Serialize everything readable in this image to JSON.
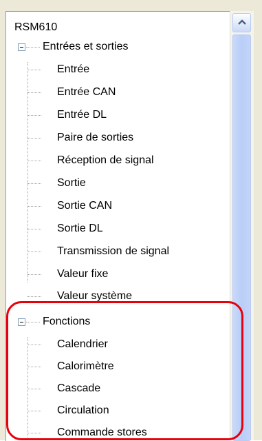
{
  "tree": {
    "root_label": "RSM610",
    "groups": [
      {
        "label": "Entrées et sorties",
        "items": [
          "Entrée",
          "Entrée CAN",
          "Entrée DL",
          "Paire de sorties",
          "Réception de signal",
          "Sortie",
          "Sortie CAN",
          "Sortie DL",
          "Transmission de signal",
          "Valeur fixe",
          "Valeur système"
        ]
      },
      {
        "label": "Fonctions",
        "items": [
          "Calendrier",
          "Calorimètre",
          "Cascade",
          "Circulation",
          "Commande stores"
        ]
      }
    ]
  },
  "colors": {
    "highlight": "#e8000b",
    "scrollbar_thumb": "#c1d3fb"
  },
  "icons": [
    "minus-expander-icon",
    "scroll-up-arrow-icon"
  ]
}
